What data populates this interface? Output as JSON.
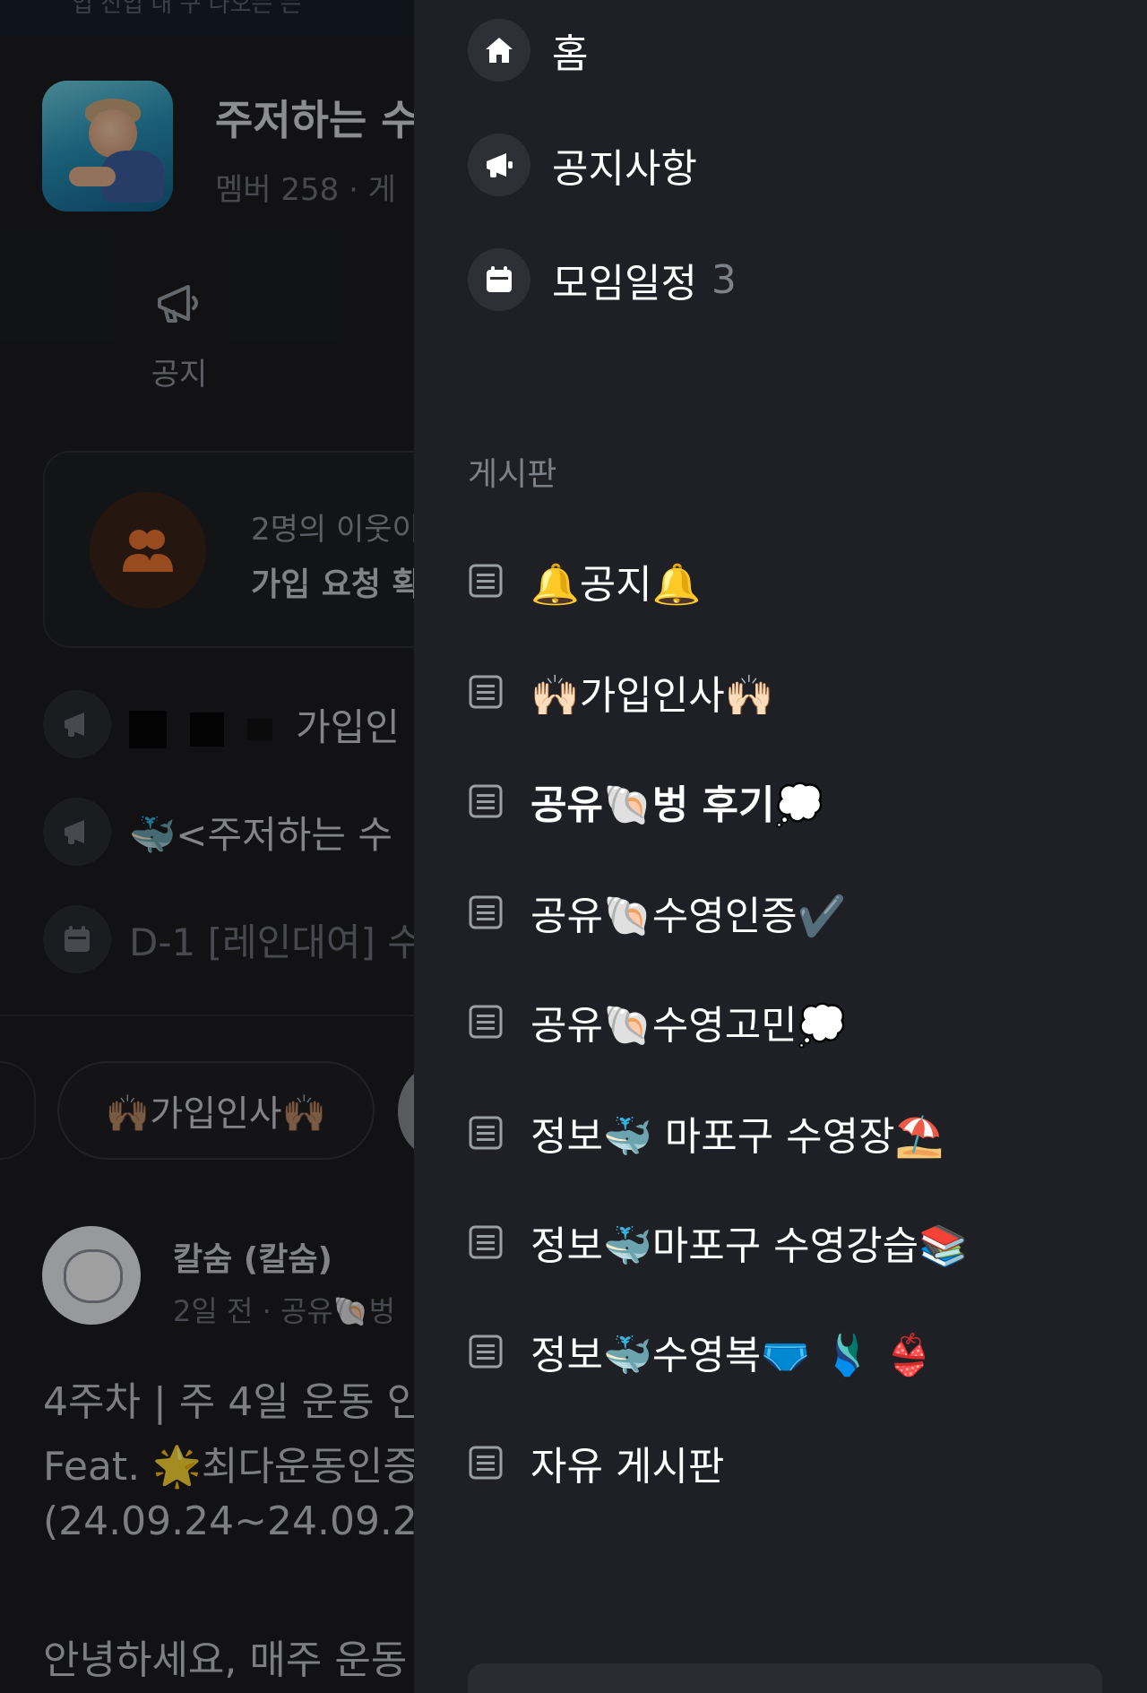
{
  "background": {
    "top_strip_text": "입 신입 내 구 나오는 는",
    "group": {
      "title": "주저하는 수",
      "meta": "멤버 258 · 게"
    },
    "notice_tab_label": "공지",
    "join_card": {
      "line1": "2명의 이웃이",
      "line2": "가입 요청 확"
    },
    "rows": [
      {
        "text": "가입인"
      },
      {
        "text": "🐳<주저하는 수"
      },
      {
        "text": "D-1 [레인대여] 수"
      }
    ],
    "chip_label": "🙌🏽가입인사🙌🏽",
    "post": {
      "author_name": "칼숨 (칼숨)",
      "author_meta": "2일 전 · 공유🐚벙",
      "lines": [
        "4주차 | 주 4일 운동 인",
        "Feat. 🌟최다운동인증",
        "(24.09.24~24.09.26",
        "안녕하세요, 매주 운동"
      ]
    }
  },
  "drawer": {
    "nav": [
      {
        "label": "홈",
        "icon": "home-icon"
      },
      {
        "label": "공지사항",
        "icon": "megaphone-icon"
      },
      {
        "label": "모임일정",
        "count": "3",
        "icon": "calendar-icon"
      }
    ],
    "section_title": "게시판",
    "boards": [
      {
        "label": "🔔공지🔔",
        "active": false
      },
      {
        "label": "🙌🏻가입인사🙌🏻",
        "active": false
      },
      {
        "label": "공유🐚벙 후기💭",
        "active": true
      },
      {
        "label": "공유🐚수영인증✔️",
        "active": false
      },
      {
        "label": "공유🐚수영고민💭",
        "active": false
      },
      {
        "label": "정보🐳 마포구 수영장⛱️",
        "active": false
      },
      {
        "label": "정보🐳마포구 수영강습📚",
        "active": false
      },
      {
        "label": "정보🐳수영복🩲 🩱 👙",
        "active": false
      },
      {
        "label": "자유 게시판",
        "active": false
      }
    ]
  },
  "colors": {
    "drawer_bg": "#1f2025",
    "icon_circle": "#2e3035",
    "muted_text": "#7d8189",
    "join_accent": "#e8742f"
  }
}
